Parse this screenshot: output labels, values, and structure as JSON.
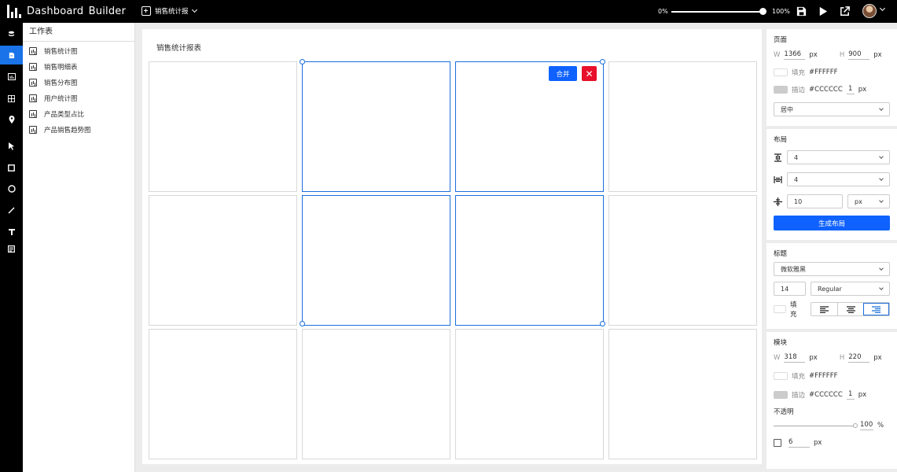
{
  "app": {
    "title": "Dashboard  Builder"
  },
  "file_menu": {
    "label": "销售统计报"
  },
  "zoom": {
    "min_label": "0%",
    "max_label": "100%",
    "value": 1.0
  },
  "toolbar_icons": [
    "save-icon",
    "play-icon",
    "open-external-icon"
  ],
  "left_rail": [
    {
      "name": "database",
      "active": false
    },
    {
      "name": "worksheet",
      "active": true
    },
    {
      "name": "chart",
      "active": false
    },
    {
      "name": "table",
      "active": false
    },
    {
      "name": "location",
      "active": false
    },
    {
      "name": "pointer",
      "active": false
    },
    {
      "name": "rectangle",
      "active": false
    },
    {
      "name": "circle",
      "active": false
    },
    {
      "name": "line",
      "active": false
    },
    {
      "name": "text",
      "active": false
    },
    {
      "name": "image",
      "active": false
    }
  ],
  "worksheets": {
    "title": "工作表",
    "items": [
      "销售统计图",
      "销售明细表",
      "销售分布图",
      "用户统计图",
      "产品类型占比",
      "产品销售趋势图"
    ]
  },
  "canvas": {
    "title": "销售统计报表",
    "merge_label": "合并",
    "close_label": "✕"
  },
  "page_props": {
    "title": "页面",
    "w_label": "W",
    "w_value": "1366",
    "w_unit": "px",
    "h_label": "H",
    "h_value": "900",
    "h_unit": "px",
    "fill_label": "填充",
    "fill_value": "#FFFFFF",
    "stroke_label": "描边",
    "stroke_value": "#CCCCCC",
    "stroke_width": "1",
    "stroke_unit": "px",
    "align_select": "居中"
  },
  "layout_props": {
    "title": "布局",
    "rows": "4",
    "cols": "4",
    "gap": "10",
    "gap_unit": "px",
    "generate_label": "生成布局"
  },
  "heading_props": {
    "title": "标题",
    "font": "微软雅黑",
    "size": "14",
    "weight": "Regular",
    "fill_label": "填充"
  },
  "block_props": {
    "title": "模块",
    "w_label": "W",
    "w_value": "318",
    "w_unit": "px",
    "h_label": "H",
    "h_value": "220",
    "h_unit": "px",
    "fill_label": "填充",
    "fill_value": "#FFFFFF",
    "stroke_label": "描边",
    "stroke_value": "#CCCCCC",
    "stroke_width": "1",
    "stroke_unit": "px",
    "opacity_label": "不透明",
    "opacity_value": "100",
    "opacity_unit": "%",
    "radius_value": "6",
    "radius_unit": "px"
  },
  "colors": {
    "accent": "#0F62FE",
    "selection": "#1A6FDB",
    "danger": "#E8102A"
  }
}
